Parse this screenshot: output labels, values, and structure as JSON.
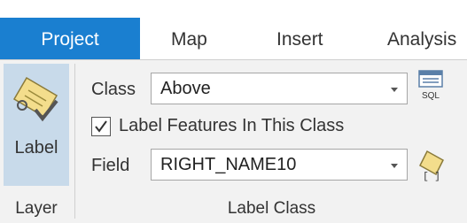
{
  "tabs": {
    "project": "Project",
    "map": "Map",
    "insert": "Insert",
    "analysis": "Analysis"
  },
  "layer_group": {
    "label_button": "Label",
    "group_name": "Layer"
  },
  "label_class_group": {
    "class_label": "Class",
    "class_value": "Above",
    "label_features_checkbox": "Label Features In This Class",
    "label_features_checked": true,
    "field_label": "Field",
    "field_value": "RIGHT_NAME10",
    "group_name": "Label Class",
    "sql_icon_text": "SQL"
  },
  "colors": {
    "active_tab": "#1a7fd0",
    "ribbon_bg": "#f2f2f2",
    "selected_button": "#c8daea"
  }
}
